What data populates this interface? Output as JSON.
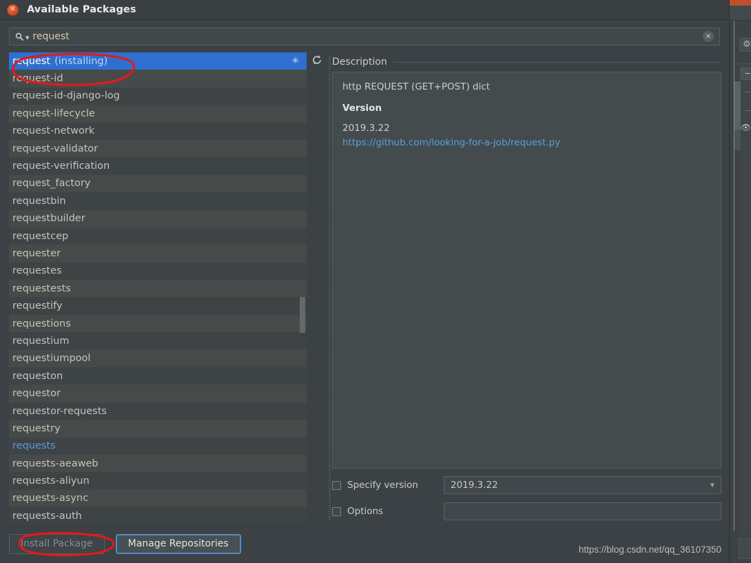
{
  "window": {
    "title": "Available Packages",
    "close_icon": "close-icon"
  },
  "search": {
    "value": "request",
    "placeholder": "",
    "icon": "search-icon",
    "dropdown_icon": "chevron-down-icon",
    "clear_icon": "clear-icon"
  },
  "list": {
    "refresh_icon": "refresh-icon",
    "spinner_icon": "loading-spinner-icon",
    "items": [
      {
        "name": "request",
        "suffix": "(installing)",
        "state": "selected"
      },
      {
        "name": "request-id",
        "suffix": "",
        "state": "normal"
      },
      {
        "name": "request-id-django-log",
        "suffix": "",
        "state": "normal"
      },
      {
        "name": "request-lifecycle",
        "suffix": "",
        "state": "normal"
      },
      {
        "name": "request-network",
        "suffix": "",
        "state": "normal"
      },
      {
        "name": "request-validator",
        "suffix": "",
        "state": "normal"
      },
      {
        "name": "request-verification",
        "suffix": "",
        "state": "normal"
      },
      {
        "name": "request_factory",
        "suffix": "",
        "state": "normal"
      },
      {
        "name": "requestbin",
        "suffix": "",
        "state": "normal"
      },
      {
        "name": "requestbuilder",
        "suffix": "",
        "state": "normal"
      },
      {
        "name": "requestcep",
        "suffix": "",
        "state": "normal"
      },
      {
        "name": "requester",
        "suffix": "",
        "state": "normal"
      },
      {
        "name": "requestes",
        "suffix": "",
        "state": "normal"
      },
      {
        "name": "requestests",
        "suffix": "",
        "state": "normal"
      },
      {
        "name": "requestify",
        "suffix": "",
        "state": "normal"
      },
      {
        "name": "requestions",
        "suffix": "",
        "state": "normal"
      },
      {
        "name": "requestium",
        "suffix": "",
        "state": "normal"
      },
      {
        "name": "requestiumpool",
        "suffix": "",
        "state": "normal"
      },
      {
        "name": "requeston",
        "suffix": "",
        "state": "normal"
      },
      {
        "name": "requestor",
        "suffix": "",
        "state": "normal"
      },
      {
        "name": "requestor-requests",
        "suffix": "",
        "state": "normal"
      },
      {
        "name": "requestry",
        "suffix": "",
        "state": "normal"
      },
      {
        "name": "requests",
        "suffix": "",
        "state": "installed"
      },
      {
        "name": "requests-aeaweb",
        "suffix": "",
        "state": "normal"
      },
      {
        "name": "requests-aliyun",
        "suffix": "",
        "state": "normal"
      },
      {
        "name": "requests-async",
        "suffix": "",
        "state": "normal"
      },
      {
        "name": "requests-auth",
        "suffix": "",
        "state": "normal"
      }
    ]
  },
  "description": {
    "header": "Description",
    "summary": "http REQUEST (GET+POST) dict",
    "version_label": "Version",
    "version_value": "2019.3.22",
    "link": "https://github.com/looking-for-a-job/request.py"
  },
  "options": {
    "specify_version_label": "Specify version",
    "specify_version_checked": false,
    "specify_version_value": "2019.3.22",
    "options_label": "Options",
    "options_checked": false,
    "options_value": "",
    "combo_caret_icon": "chevron-down-icon"
  },
  "footer": {
    "install_label": "Install Package",
    "install_disabled": true,
    "manage_label": "Manage Repositories"
  },
  "watermark": {
    "text": "https://blog.csdn.net/qq_36107350"
  },
  "background_ide": {
    "gear_icon": "gear-icon",
    "minus_icon": "minus-icon",
    "eye_icon": "eye-icon"
  },
  "colors": {
    "selection_blue": "#2f6fcf",
    "installed_blue": "#5b9bd8",
    "link_blue": "#5d9ddb",
    "annotation_red": "#e01b1b",
    "dialog_bg": "#3c4145",
    "desc_bg": "#444b4d"
  }
}
